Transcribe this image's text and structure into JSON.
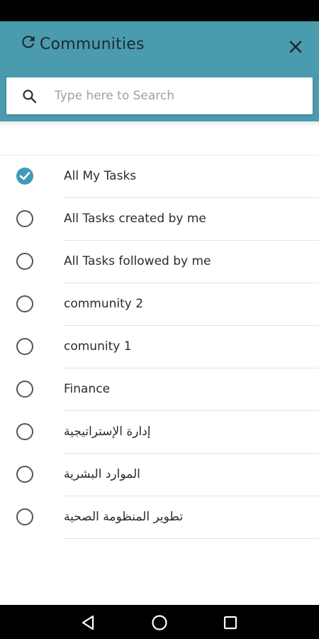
{
  "header": {
    "title": "Communities",
    "refresh_icon": "refresh-icon",
    "close_icon": "close-icon",
    "color": "#4A9BAE"
  },
  "search": {
    "placeholder": "Type here to Search",
    "value": "",
    "icon": "search-icon"
  },
  "list": {
    "items": [
      {
        "label": "All My Tasks",
        "selected": true
      },
      {
        "label": "All Tasks created by me",
        "selected": false
      },
      {
        "label": "All Tasks followed by me",
        "selected": false
      },
      {
        "label": "community 2",
        "selected": false
      },
      {
        "label": "comunity 1",
        "selected": false
      },
      {
        "label": "Finance",
        "selected": false
      },
      {
        "label": "إدارة الإستراتيجية",
        "selected": false
      },
      {
        "label": "الموارد البشرية",
        "selected": false
      },
      {
        "label": "تطوير المنظومة الصحية",
        "selected": false
      }
    ],
    "selected_color": "#3d9ab8"
  },
  "nav": {
    "back_icon": "back-triangle-icon",
    "home_icon": "home-circle-icon",
    "recents_icon": "recents-square-icon"
  }
}
